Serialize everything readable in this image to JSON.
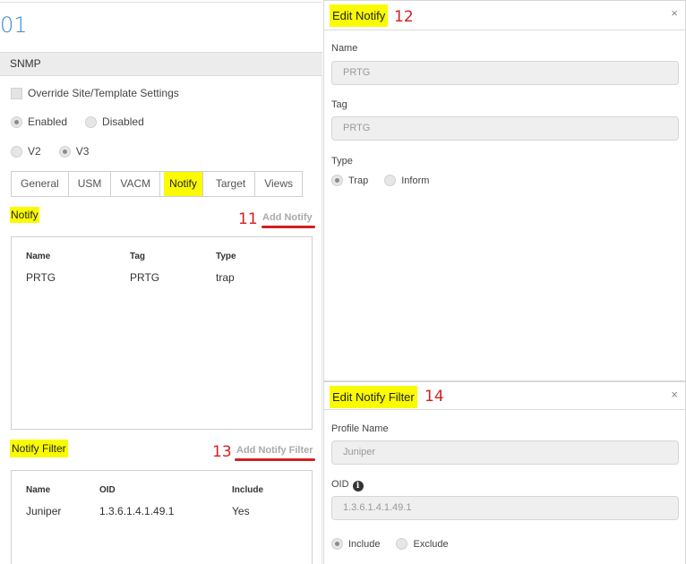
{
  "page": {
    "number_fragment": "01"
  },
  "snmp": {
    "header": "SNMP",
    "override_label": "Override Site/Template Settings",
    "state_enabled": "Enabled",
    "state_disabled": "Disabled",
    "version_v2": "V2",
    "version_v3": "V3",
    "selected_state": "Enabled",
    "selected_version": "V3"
  },
  "tabs": [
    {
      "label": "General"
    },
    {
      "label": "USM"
    },
    {
      "label": "VACM"
    },
    {
      "label": "Notify",
      "active": true
    },
    {
      "label": "Target"
    },
    {
      "label": "Views"
    }
  ],
  "notify": {
    "title": "Notify",
    "add_link": "Add Notify",
    "annotation": "11",
    "columns": [
      "Name",
      "Tag",
      "Type"
    ],
    "rows": [
      [
        "PRTG",
        "PRTG",
        "trap"
      ]
    ]
  },
  "notify_filter": {
    "title": "Notify Filter",
    "add_link": "Add Notify Filter",
    "annotation": "13",
    "columns": [
      "Name",
      "OID",
      "Include"
    ],
    "rows": [
      [
        "Juniper",
        "1.3.6.1.4.1.49.1",
        "Yes"
      ]
    ]
  },
  "edit_notify": {
    "title": "Edit Notify",
    "annotation": "12",
    "close": "×",
    "name_label": "Name",
    "name_value": "PRTG",
    "tag_label": "Tag",
    "tag_value": "PRTG",
    "type_label": "Type",
    "type_trap": "Trap",
    "type_inform": "Inform",
    "selected_type": "Trap"
  },
  "edit_notify_filter": {
    "title": "Edit Notify Filter",
    "annotation": "14",
    "close": "×",
    "profile_label": "Profile Name",
    "profile_value": "Juniper",
    "oid_label": "OID",
    "oid_value": "1.3.6.1.4.1.49.1",
    "include_label": "Include",
    "exclude_label": "Exclude",
    "selected": "Include"
  },
  "colors": {
    "highlight": "#fafa00",
    "annotation_red": "#d42020",
    "accent_blue": "#3b8ec9"
  }
}
